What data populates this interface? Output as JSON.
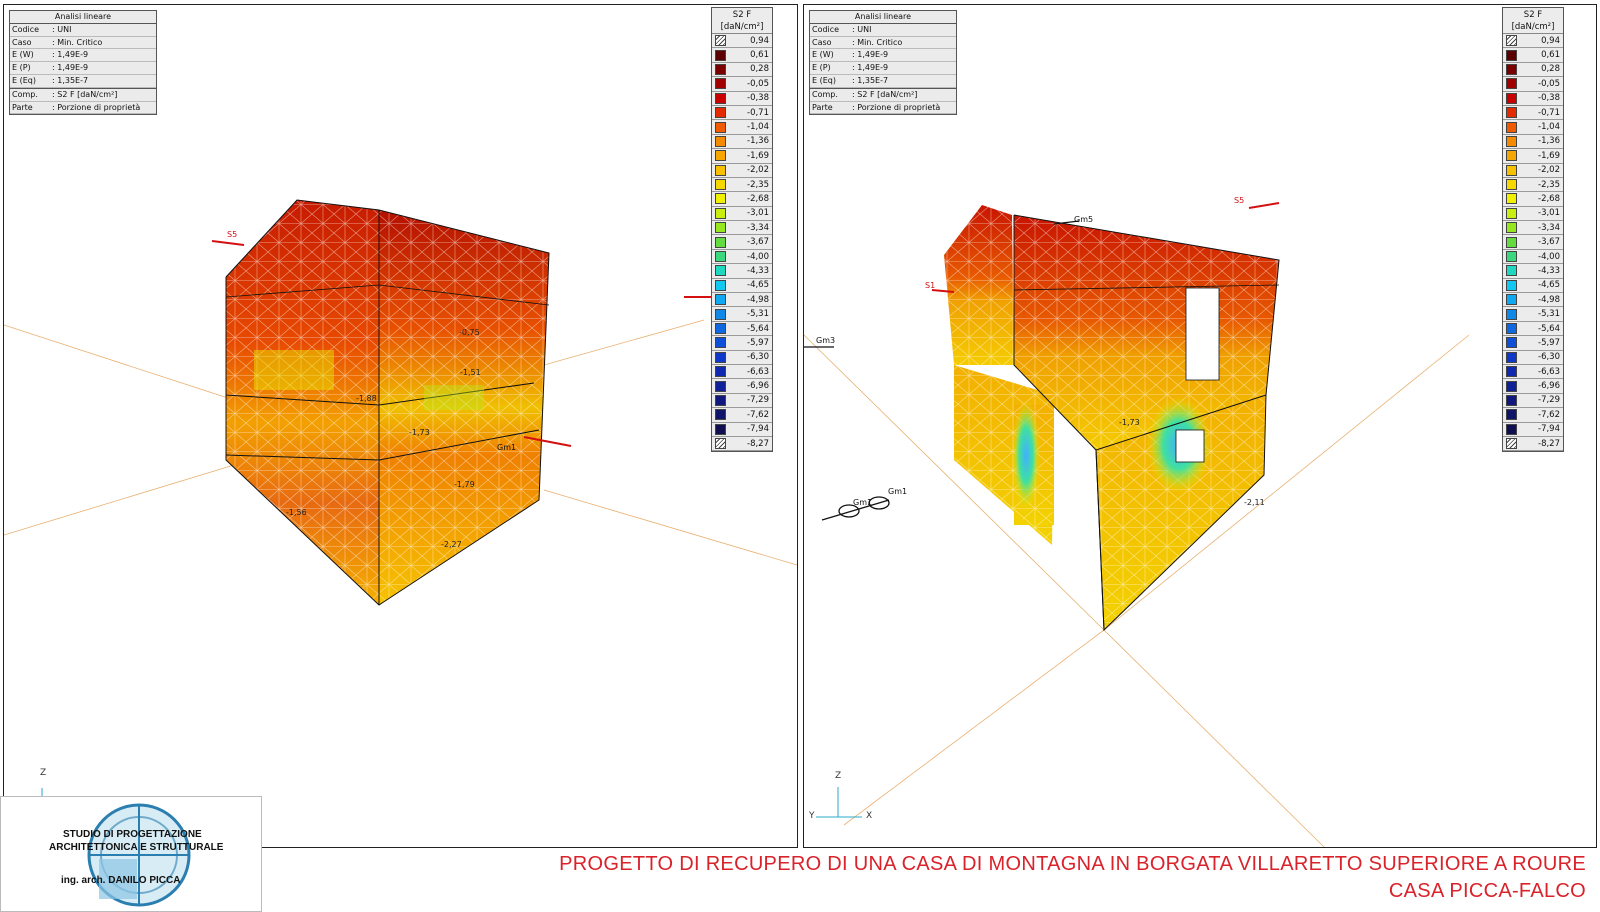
{
  "info_box": {
    "title": "Analisi lineare",
    "rows": [
      {
        "k": "Codice",
        "v": ": UNI"
      },
      {
        "k": "Caso",
        "v": ": Min. Critico"
      },
      {
        "k": "E (W)",
        "v": ": 1,49E-9"
      },
      {
        "k": "E (P)",
        "v": ": 1,49E-9"
      },
      {
        "k": "E (Eq)",
        "v": ": 1,35E-7"
      },
      {
        "k": "Comp.",
        "v": ": S2 F [daN/cm²]"
      },
      {
        "k": "Parte",
        "v": ": Porzione di proprietà"
      }
    ]
  },
  "legend": {
    "title": "S2 F",
    "unit": "[daN/cm²]",
    "values": [
      "0,94",
      "0,61",
      "0,28",
      "-0,05",
      "-0,38",
      "-0,71",
      "-1,04",
      "-1,36",
      "-1,69",
      "-2,02",
      "-2,35",
      "-2,68",
      "-3,01",
      "-3,34",
      "-3,67",
      "-4,00",
      "-4,33",
      "-4,65",
      "-4,98",
      "-5,31",
      "-5,64",
      "-5,97",
      "-6,30",
      "-6,63",
      "-6,96",
      "-7,29",
      "-7,62",
      "-7,94",
      "-8,27"
    ],
    "colors": [
      "#5a0000",
      "#7a0000",
      "#a00000",
      "#c80000",
      "#e52a00",
      "#f05a00",
      "#f38a00",
      "#f5a600",
      "#f7c000",
      "#f5d800",
      "#f0f000",
      "#c8ee10",
      "#96e620",
      "#64dc40",
      "#3cd880",
      "#20d8c0",
      "#10c8f0",
      "#10a8f0",
      "#1088e8",
      "#1068e0",
      "#1050d8",
      "#1038c8",
      "#1028b0",
      "#102098",
      "#101880",
      "#101468",
      "#101050",
      "#0c0c3c"
    ]
  },
  "axes": {
    "z": "Z",
    "y": "Y",
    "x": "X"
  },
  "left_labels": [
    "S5",
    "Gm1",
    "-1,56",
    "-1,79",
    "-2,27",
    "-1,51",
    "-1,73",
    "-0,75",
    "-1,88"
  ],
  "right_labels": [
    "S5",
    "S1",
    "Gm3",
    "Gm5",
    "Gm1",
    "Gm1",
    "-1,73",
    "-2,11"
  ],
  "logo": {
    "line1": "STUDIO DI PROGETTAZIONE",
    "line2": "ARCHITETTONICA E STRUTTURALE",
    "line3": "ing. arch. DANILO PICCA"
  },
  "project": {
    "title_line1": "PROGETTO DI RECUPERO DI UNA CASA DI MONTAGNA IN BORGATA VILLARETTO SUPERIORE A ROURE",
    "title_line2": "CASA PICCA-FALCO"
  },
  "colors": {
    "title_red": "#d9222a",
    "axis_orange": "#e8b070"
  }
}
